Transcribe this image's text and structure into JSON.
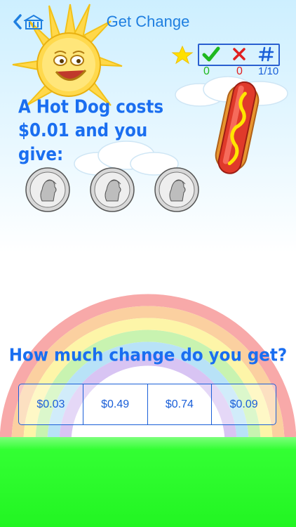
{
  "header": {
    "title": "Get Change",
    "back_icon": "chevron-left-icon",
    "home_icon": "building-icon"
  },
  "score": {
    "star_icon": "star-icon",
    "correct_icon": "check-icon",
    "wrong_icon": "x-icon",
    "number_icon": "hash-icon",
    "correct": "0",
    "wrong": "0",
    "progress": "1/10",
    "correct_color": "#1fb81f",
    "wrong_color": "#e02020",
    "number_color": "#1a5fd8"
  },
  "question": {
    "line1": "A Hot Dog costs",
    "line2": "$0.01 and you",
    "line3": "give:",
    "item_icon": "hot-dog-icon",
    "coin_icon": "quarter-coin-icon",
    "coins": [
      {
        "label": "QUARTER DOLLAR"
      },
      {
        "label": "QUARTER DOLLAR"
      },
      {
        "label": "QUARTER DOLLAR"
      }
    ]
  },
  "prompt": "How much change do you get?",
  "answers": [
    "$0.03",
    "$0.49",
    "$0.74",
    "$0.09"
  ],
  "colors": {
    "accent": "#1a6ef0",
    "grass": "#33ff33",
    "sky": "#cdefff"
  }
}
